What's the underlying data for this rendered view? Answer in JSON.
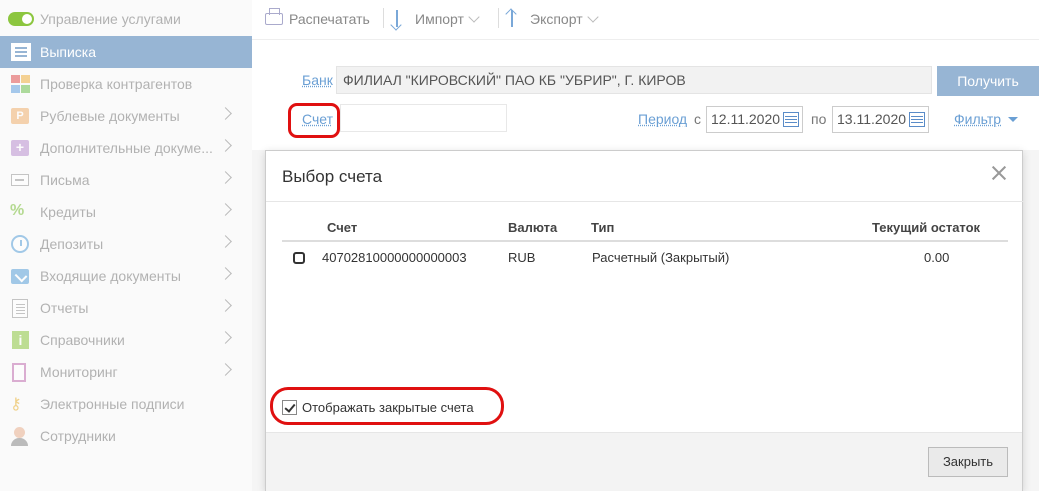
{
  "sidebar": {
    "services": "Управление услугами",
    "items": [
      {
        "label": "Выписка"
      },
      {
        "label": "Проверка контрагентов"
      },
      {
        "label": "Рублевые документы"
      },
      {
        "label": "Дополнительные докуме..."
      },
      {
        "label": "Письма"
      },
      {
        "label": "Кредиты"
      },
      {
        "label": "Депозиты"
      },
      {
        "label": "Входящие документы"
      },
      {
        "label": "Отчеты"
      },
      {
        "label": "Справочники"
      },
      {
        "label": "Мониторинг"
      },
      {
        "label": "Электронные подписи"
      },
      {
        "label": "Сотрудники"
      }
    ],
    "rub_icon_glyph": "Р",
    "plus_icon_glyph": "+",
    "credit_icon_glyph": "%",
    "info_icon_glyph": "i",
    "key_icon_glyph": "⚷",
    "active_color": "#97b5d4"
  },
  "toolbar": {
    "print": "Распечатать",
    "import": "Импорт",
    "export": "Экспорт"
  },
  "form": {
    "bank_label": "Банк",
    "bank_value": "ФИЛИАЛ \"КИРОВСКИЙ\" ПАО КБ \"УБРИР\", Г. КИРОВ",
    "get_button": "Получить",
    "account_label": "Счет",
    "period_label": "Период",
    "from_label": "с",
    "date_from": "12.11.2020",
    "to_label": "по",
    "date_to": "13.11.2020",
    "filter_label": "Фильтр"
  },
  "modal": {
    "title": "Выбор счета",
    "columns": {
      "account": "Счет",
      "currency": "Валюта",
      "type": "Тип",
      "balance": "Текущий остаток"
    },
    "rows": [
      {
        "account": "40702810000000000003",
        "currency": "RUB",
        "type": "Расчетный (Закрытый)",
        "balance": "0.00"
      }
    ],
    "show_closed_label": "Отображать закрытые счета",
    "show_closed_checked": true,
    "close_button": "Закрыть"
  },
  "colors": {
    "accent": "#97b5d4",
    "link": "#6a9fd4",
    "highlight": "#e01010"
  }
}
